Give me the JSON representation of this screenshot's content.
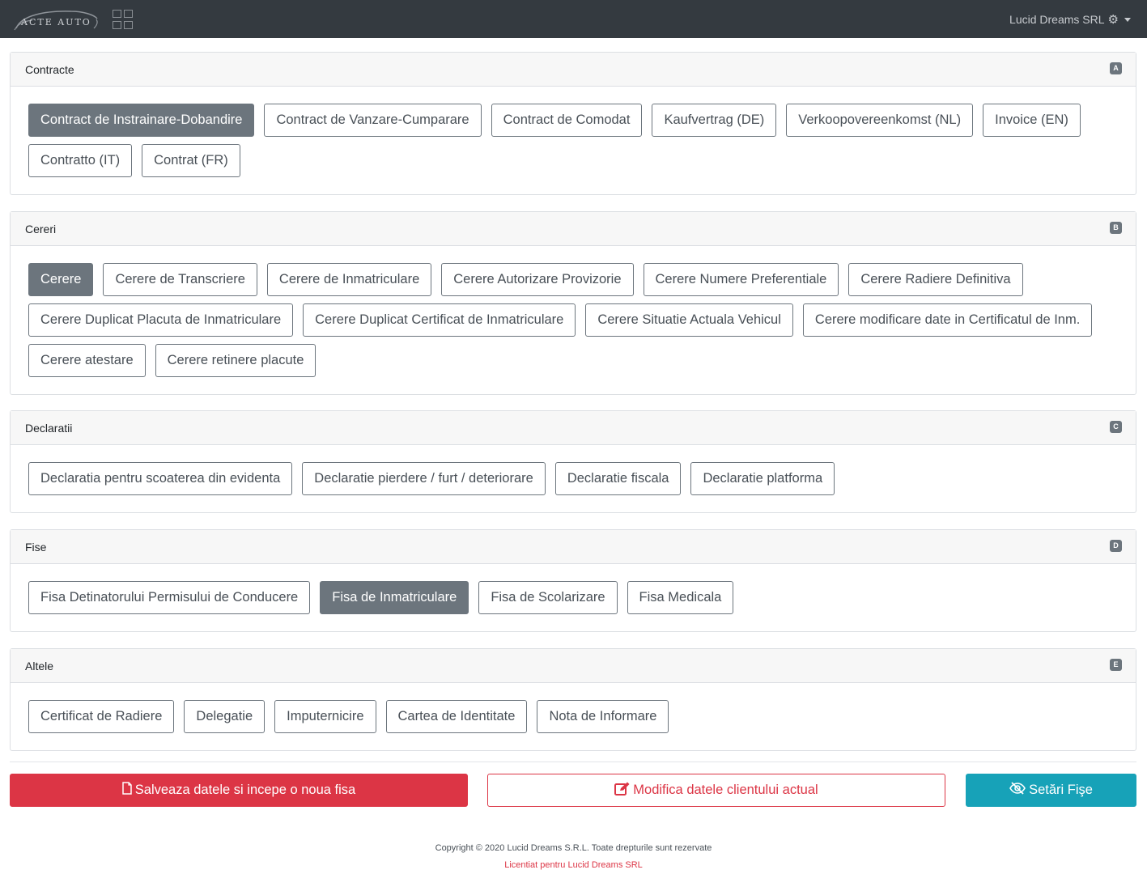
{
  "navbar": {
    "logo_text": "ACTE AUTO",
    "user_name": "Lucid Dreams SRL"
  },
  "sections": [
    {
      "title": "Contracte",
      "key": "A",
      "buttons": [
        {
          "label": "Contract de Instrainare-Dobandire",
          "active": true
        },
        {
          "label": "Contract de Vanzare-Cumparare",
          "active": false
        },
        {
          "label": "Contract de Comodat",
          "active": false
        },
        {
          "label": "Kaufvertrag (DE)",
          "active": false
        },
        {
          "label": "Verkoopovereenkomst (NL)",
          "active": false
        },
        {
          "label": "Invoice (EN)",
          "active": false
        },
        {
          "label": "Contratto (IT)",
          "active": false
        },
        {
          "label": "Contrat (FR)",
          "active": false
        }
      ]
    },
    {
      "title": "Cereri",
      "key": "B",
      "buttons": [
        {
          "label": "Cerere",
          "active": true
        },
        {
          "label": "Cerere de Transcriere",
          "active": false
        },
        {
          "label": "Cerere de Inmatriculare",
          "active": false
        },
        {
          "label": "Cerere Autorizare Provizorie",
          "active": false
        },
        {
          "label": "Cerere Numere Preferentiale",
          "active": false
        },
        {
          "label": "Cerere Radiere Definitiva",
          "active": false
        },
        {
          "label": "Cerere Duplicat Placuta de Inmatriculare",
          "active": false
        },
        {
          "label": "Cerere Duplicat Certificat de Inmatriculare",
          "active": false
        },
        {
          "label": "Cerere Situatie Actuala Vehicul",
          "active": false
        },
        {
          "label": "Cerere modificare date in Certificatul de Inm.",
          "active": false
        },
        {
          "label": "Cerere atestare",
          "active": false
        },
        {
          "label": "Cerere retinere placute",
          "active": false
        }
      ]
    },
    {
      "title": "Declaratii",
      "key": "C",
      "buttons": [
        {
          "label": "Declaratia pentru scoaterea din evidenta",
          "active": false
        },
        {
          "label": "Declaratie pierdere / furt / deteriorare",
          "active": false
        },
        {
          "label": "Declaratie fiscala",
          "active": false
        },
        {
          "label": "Declaratie platforma",
          "active": false
        }
      ]
    },
    {
      "title": "Fise",
      "key": "D",
      "buttons": [
        {
          "label": "Fisa Detinatorului Permisului de Conducere",
          "active": false
        },
        {
          "label": "Fisa de Inmatriculare",
          "active": true
        },
        {
          "label": "Fisa de Scolarizare",
          "active": false
        },
        {
          "label": "Fisa Medicala",
          "active": false
        }
      ]
    },
    {
      "title": "Altele",
      "key": "E",
      "buttons": [
        {
          "label": "Certificat de Radiere",
          "active": false
        },
        {
          "label": "Delegatie",
          "active": false
        },
        {
          "label": "Imputernicire",
          "active": false
        },
        {
          "label": "Cartea de Identitate",
          "active": false
        },
        {
          "label": "Nota de Informare",
          "active": false
        }
      ]
    }
  ],
  "actions": {
    "save_label": "Salveaza datele si incepe o noua fisa",
    "edit_label": "Modifica datele clientului actual",
    "settings_label": "Setări Fişe"
  },
  "footer": {
    "copyright": "Copyright © 2020 Lucid Dreams S.R.L. Toate drepturile sunt rezervate",
    "license": "Licentiat pentru Lucid Dreams SRL"
  },
  "colors": {
    "navbar": "#343a40",
    "active_button": "#6c757d",
    "danger": "#dc3545",
    "info": "#17a2b8"
  },
  "icons": [
    "grid-icon",
    "gear-icon",
    "chevron-down-icon",
    "file-icon",
    "edit-icon",
    "eye-slash-icon"
  ]
}
